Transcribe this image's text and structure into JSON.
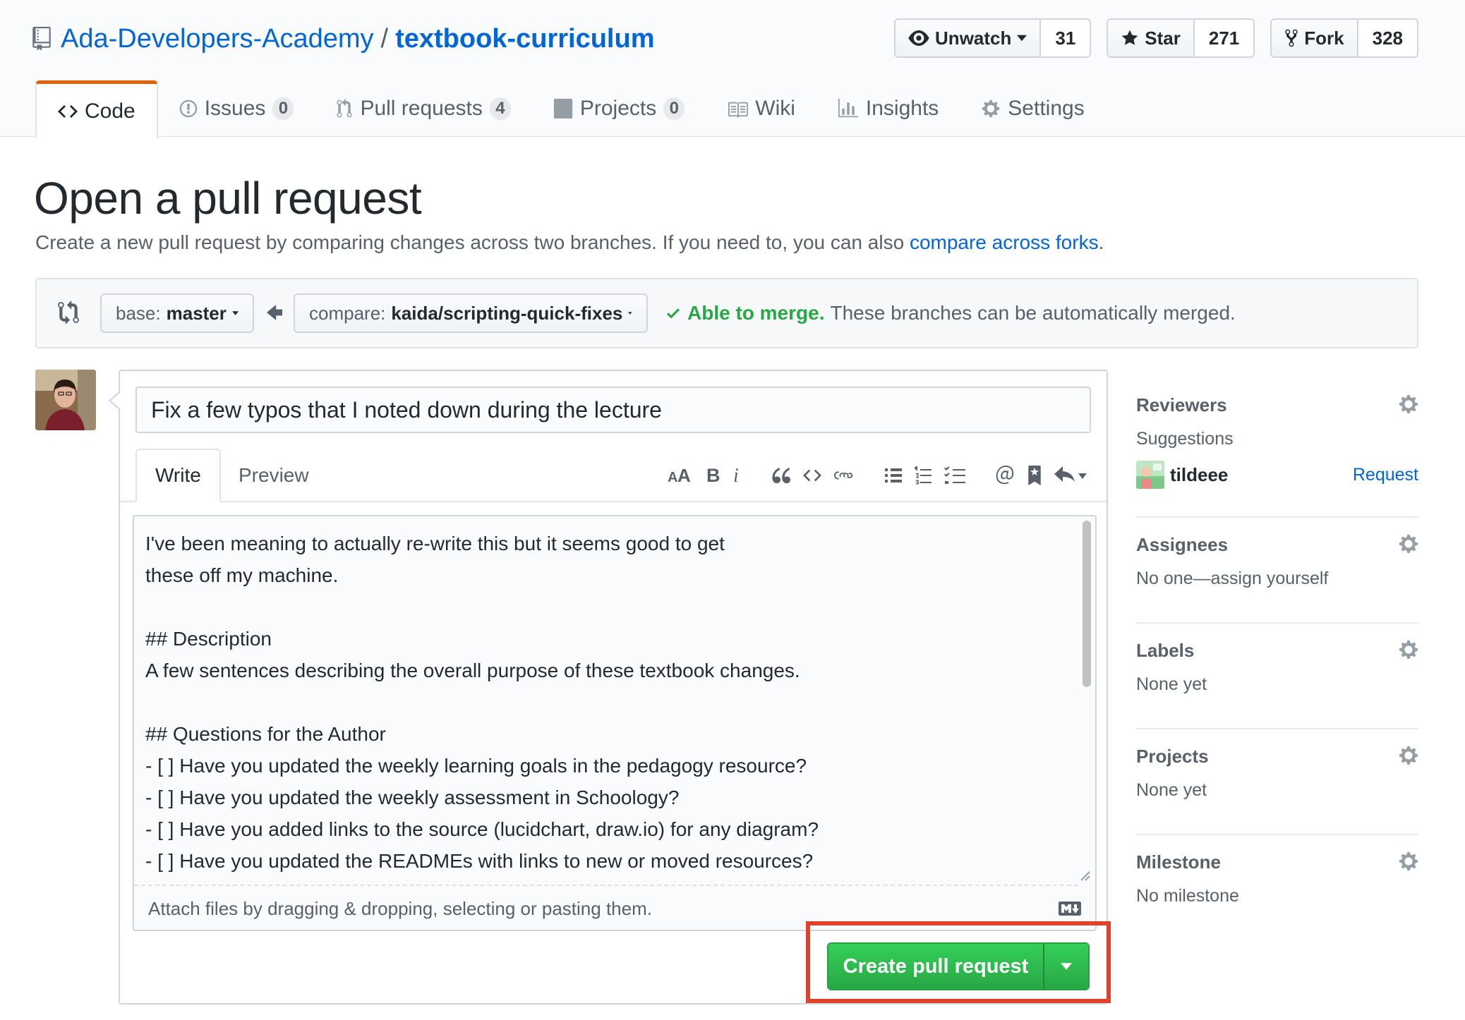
{
  "repo": {
    "owner": "Ada-Developers-Academy",
    "separator": "/",
    "name": "textbook-curriculum"
  },
  "actions": {
    "watch": {
      "label": "Unwatch",
      "count": "31"
    },
    "star": {
      "label": "Star",
      "count": "271"
    },
    "fork": {
      "label": "Fork",
      "count": "328"
    }
  },
  "nav": {
    "tabs": [
      {
        "label": "Code",
        "icon": "code-icon",
        "selected": true
      },
      {
        "label": "Issues",
        "icon": "issue-icon",
        "counter": "0"
      },
      {
        "label": "Pull requests",
        "icon": "pull-request-icon",
        "counter": "4"
      },
      {
        "label": "Projects",
        "icon": "project-icon",
        "counter": "0"
      },
      {
        "label": "Wiki",
        "icon": "book-icon"
      },
      {
        "label": "Insights",
        "icon": "graph-icon"
      },
      {
        "label": "Settings",
        "icon": "gear-icon"
      }
    ]
  },
  "page": {
    "title": "Open a pull request",
    "subtitle_prefix": "Create a new pull request by comparing changes across two branches. If you need to, you can also ",
    "subtitle_link": "compare across forks",
    "subtitle_suffix": "."
  },
  "range": {
    "base_prefix": "base:",
    "base_branch": "master",
    "compare_prefix": "compare:",
    "compare_branch": "kaida/scripting-quick-fixes",
    "merge_ok": "Able to merge.",
    "merge_text": "These branches can be automatically merged."
  },
  "form": {
    "title_value": "Fix a few typos that I noted down during the lecture",
    "tab_write": "Write",
    "tab_preview": "Preview",
    "body": "I've been meaning to actually re-write this but it seems good to get\nthese off my machine.\n\n## Description\nA few sentences describing the overall purpose of these textbook changes.\n\n## Questions for the Author\n- [ ] Have you updated the weekly learning goals in the pedagogy resource?\n- [ ] Have you updated the weekly assessment in Schoology?\n- [ ] Have you added links to the source (lucidchart, draw.io) for any diagram?\n- [ ] Have you updated the READMEs with links to new or moved resources?",
    "attach_hint": "Attach files by dragging & dropping, selecting or pasting them.",
    "submit_label": "Create pull request"
  },
  "sidebar": {
    "reviewers": {
      "heading": "Reviewers",
      "suggestions_label": "Suggestions",
      "suggested_user": "tildeee",
      "request_label": "Request"
    },
    "assignees": {
      "heading": "Assignees",
      "value": "No one—assign yourself"
    },
    "labels": {
      "heading": "Labels",
      "value": "None yet"
    },
    "projects": {
      "heading": "Projects",
      "value": "None yet"
    },
    "milestone": {
      "heading": "Milestone",
      "value": "No milestone"
    }
  },
  "colors": {
    "link": "#0366d6",
    "success": "#28a745",
    "tab_accent": "#e36209",
    "highlight": "#e0412a"
  }
}
